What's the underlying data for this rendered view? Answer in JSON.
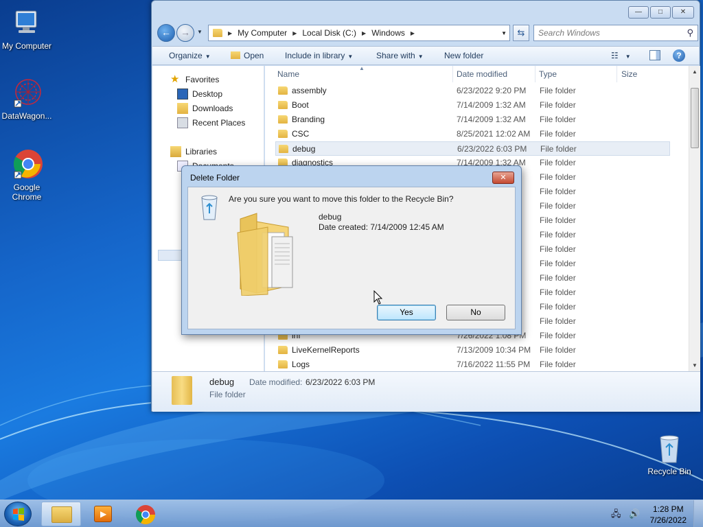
{
  "desktop": {
    "icons": [
      {
        "label": "My Computer"
      },
      {
        "label": "DataWagon..."
      },
      {
        "label": "Google Chrome"
      },
      {
        "label": "Recycle Bin"
      }
    ]
  },
  "explorer": {
    "title_buttons": {
      "minimize": "—",
      "maximize": "□",
      "close": "✕"
    },
    "address": {
      "crumbs": [
        "My Computer",
        "Local Disk (C:)",
        "Windows"
      ],
      "separator": "▶"
    },
    "search": {
      "placeholder": "Search Windows"
    },
    "toolbar": {
      "organize": "Organize",
      "open": "Open",
      "include_in_library": "Include in library",
      "share_with": "Share with",
      "new_folder": "New folder"
    },
    "nav_pane": {
      "favorites": "Favorites",
      "desktop": "Desktop",
      "downloads": "Downloads",
      "recent_places": "Recent Places",
      "libraries": "Libraries",
      "documents_partial": "Documents"
    },
    "columns": {
      "name": "Name",
      "date_modified": "Date modified",
      "type": "Type",
      "size": "Size"
    },
    "rows": [
      {
        "name": "assembly",
        "date": "6/23/2022 9:20 PM",
        "type": "File folder"
      },
      {
        "name": "Boot",
        "date": "7/14/2009 1:32 AM",
        "type": "File folder"
      },
      {
        "name": "Branding",
        "date": "7/14/2009 1:32 AM",
        "type": "File folder"
      },
      {
        "name": "CSC",
        "date": "8/25/2021 12:02 AM",
        "type": "File folder"
      },
      {
        "name": "debug",
        "date": "6/23/2022 6:03 PM",
        "type": "File folder"
      },
      {
        "name": "diagnostics",
        "date": "7/14/2009 1:32 AM",
        "type": "File folder"
      },
      {
        "name": "",
        "date": "",
        "type": "File folder"
      },
      {
        "name": "",
        "date": "",
        "type": "File folder"
      },
      {
        "name": "",
        "date": "",
        "type": "File folder"
      },
      {
        "name": "",
        "date": "",
        "type": "File folder"
      },
      {
        "name": "",
        "date": "",
        "type": "File folder"
      },
      {
        "name": "",
        "date": "",
        "type": "File folder"
      },
      {
        "name": "",
        "date": "",
        "type": "File folder"
      },
      {
        "name": "",
        "date": "",
        "type": "File folder"
      },
      {
        "name": "",
        "date": "",
        "type": "File folder"
      },
      {
        "name": "",
        "date": "",
        "type": "File folder"
      },
      {
        "name": "",
        "date": "",
        "type": "File folder"
      },
      {
        "name": "inf",
        "date": "7/26/2022 1:08 PM",
        "type": "File folder"
      },
      {
        "name": "LiveKernelReports",
        "date": "7/13/2009 10:34 PM",
        "type": "File folder"
      },
      {
        "name": "Logs",
        "date": "7/16/2022 11:55 PM",
        "type": "File folder"
      }
    ],
    "details": {
      "name": "debug",
      "date_label": "Date modified:",
      "date_value": "6/23/2022 6:03 PM",
      "type": "File folder"
    }
  },
  "dialog": {
    "title": "Delete Folder",
    "close": "✕",
    "question": "Are you sure you want to move this folder to the Recycle Bin?",
    "item_name": "debug",
    "item_created": "Date created: 7/14/2009 12:45 AM",
    "yes": "Yes",
    "no": "No"
  },
  "taskbar": {
    "time": "1:28 PM",
    "date": "7/26/2022"
  }
}
